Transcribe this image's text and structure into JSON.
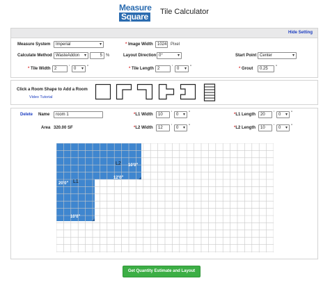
{
  "header": {
    "logo_line1": "Measure",
    "logo_line2": "Square",
    "title": "Tile Calculator"
  },
  "settings": {
    "hide_label": "Hide Setting",
    "measure_system": {
      "label": "Measure System",
      "value": "Imperial"
    },
    "image_width": {
      "label": "Image Width",
      "value": "1024",
      "unit": "Pixel"
    },
    "calculate_method": {
      "label": "Calculate Method",
      "value": "WasteAddon",
      "percent": "5",
      "unit": "%"
    },
    "layout_direction": {
      "label": "Layout Direction",
      "value": "0°"
    },
    "start_point": {
      "label": "Start Point",
      "value": "Center"
    },
    "tile_width": {
      "label": "Tile Width",
      "feet": "2",
      "inches": "0",
      "unit": "\""
    },
    "tile_length": {
      "label": "Tile Length",
      "feet": "2",
      "inches": "0",
      "unit": "\""
    },
    "grout": {
      "label": "Grout",
      "value": "0.25",
      "unit": "\""
    },
    "feet_unit": "'"
  },
  "shapes": {
    "title": "Click a Room Shape to Add a Room",
    "video_link": "Video Tutorial",
    "icons": [
      "rectangle-shape-icon",
      "l-shape-icon",
      "reverse-l-shape-icon",
      "notch-shape-icon",
      "t-shape-icon",
      "stairs-shape-icon"
    ]
  },
  "room": {
    "delete_label": "Delete",
    "name_label": "Name",
    "name_value": "room 1",
    "area_label": "Area",
    "area_value": "320.00 SF",
    "l1_width": {
      "label": "L1 Width",
      "feet": "10",
      "inches": "0"
    },
    "l1_length": {
      "label": "L1 Length",
      "feet": "20",
      "inches": "0"
    },
    "l2_width": {
      "label": "L2 Width",
      "feet": "12",
      "inches": "0"
    },
    "l2_length": {
      "label": "L2 Length",
      "feet": "10",
      "inches": "0"
    },
    "unit_in": "\"",
    "unit_ft": "'"
  },
  "layout": {
    "label_l1": "L1",
    "label_l2": "L2",
    "dim_left": "20'0\"",
    "dim_top_right": "10'0\"",
    "dim_mid": "12'0\"",
    "dim_bottom": "10'0\"",
    "fill_color": "#3f86cf"
  },
  "cta": {
    "label": "Get Quantity Estimate and Layout",
    "color": "#3cae45"
  }
}
